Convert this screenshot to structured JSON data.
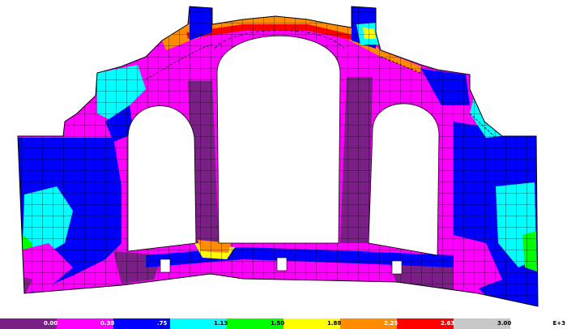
{
  "legend": {
    "colors": [
      "#7a1f86",
      "#ff00ff",
      "#0000ff",
      "#00ffff",
      "#00ff00",
      "#ffff00",
      "#ff8c00",
      "#ff0000",
      "#c8c8c8",
      "#ffffff"
    ],
    "labels": [
      "0.00",
      "0.38",
      ".75",
      "1.13",
      "1.50",
      "1.88",
      "2.25",
      "2.63",
      "3.00"
    ],
    "exponent": "E+3"
  },
  "palette": {
    "dark_purple": "#7a1f86",
    "magenta": "#ff00ff",
    "blue": "#0000ff",
    "cyan": "#00ffff",
    "green": "#00ff00",
    "yellow": "#ffff00",
    "orange": "#ff8c00",
    "red": "#ff0000",
    "mesh": "#000000"
  }
}
